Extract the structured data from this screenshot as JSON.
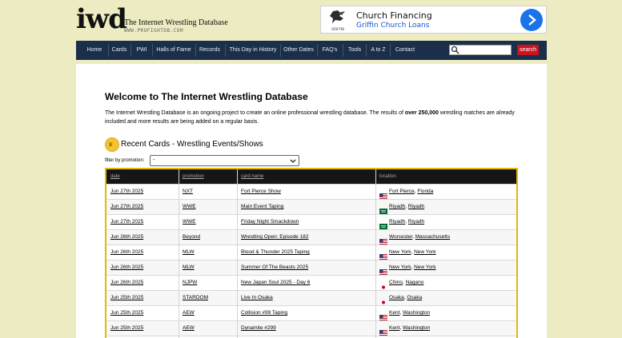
{
  "logo": {
    "mark": "iwd",
    "title": "The Internet Wrestling Database",
    "url": "WWW.PROFIGHTDB.COM"
  },
  "ad": {
    "logo_text": "GRIFFIN",
    "title": "Church Financing",
    "subtitle": "Griffin Church Loans"
  },
  "nav": {
    "items": [
      "Home",
      "Cards",
      "PWI",
      "Halls of Fame",
      "Records",
      "This Day in History",
      "Other Dates",
      "FAQ's",
      "Tools",
      "A to Z",
      "Contact"
    ],
    "search_value": "",
    "search_button": "search"
  },
  "main": {
    "title": "Welcome to The Internet Wrestling Database",
    "intro_before": "The Internet Wrestling Database is an ongoing project to create an online professional wrestling database. The results of ",
    "intro_bold": "over 250,000",
    "intro_after": " wrestling matches are already included and more results are being added on a regular basis.",
    "recent_title": "Recent Cards - Wrestling Events/Shows",
    "filter_label": "filter by promotion:",
    "filter_value": "-"
  },
  "table": {
    "headers": [
      "date",
      "promotion",
      "card name",
      "location"
    ],
    "rows": [
      {
        "date": "Jun 27th 2025",
        "promotion": "NXT",
        "card": "Fort Pierce Show",
        "city": "Fort Pierce",
        "region": "Florida",
        "flag": "us"
      },
      {
        "date": "Jun 27th 2025",
        "promotion": "WWE",
        "card": "Main Event Taping",
        "city": "Riyadh",
        "region": "Riyadh",
        "flag": "sa"
      },
      {
        "date": "Jun 27th 2025",
        "promotion": "WWE",
        "card": "Friday Night Smackdown",
        "city": "Riyadh",
        "region": "Riyadh",
        "flag": "sa"
      },
      {
        "date": "Jun 26th 2025",
        "promotion": "Beyond",
        "card": "Wrestling Open: Episode 182",
        "city": "Worcester",
        "region": "Massachusetts",
        "flag": "us"
      },
      {
        "date": "Jun 26th 2025",
        "promotion": "MLW",
        "card": "Blood & Thunder 2025 Taping",
        "city": "New York",
        "region": "New York",
        "flag": "us"
      },
      {
        "date": "Jun 26th 2025",
        "promotion": "MLW",
        "card": "Summer Of The Beasts 2025",
        "city": "New York",
        "region": "New York",
        "flag": "us"
      },
      {
        "date": "Jun 26th 2025",
        "promotion": "NJPW",
        "card": "New Japan Soul 2025 - Day 6",
        "city": "Chino",
        "region": "Nagano",
        "flag": "jp"
      },
      {
        "date": "Jun 25th 2025",
        "promotion": "STARDOM",
        "card": "Live In Osaka",
        "city": "Osaka",
        "region": "Osaka",
        "flag": "jp"
      },
      {
        "date": "Jun 25th 2025",
        "promotion": "AEW",
        "card": "Collision #99 Taping",
        "city": "Kent",
        "region": "Washington",
        "flag": "us"
      },
      {
        "date": "Jun 25th 2025",
        "promotion": "AEW",
        "card": "Dynamite #299",
        "city": "Kent",
        "region": "Washington",
        "flag": "us"
      },
      {
        "date": "",
        "promotion": "",
        "card": "",
        "city": "",
        "region": "",
        "flag": ""
      }
    ]
  },
  "colors": {
    "nav_bg": "#1b2f4a",
    "page_bg": "#ecebc1",
    "table_border": "#e6b800",
    "search_button": "#c8141f"
  }
}
